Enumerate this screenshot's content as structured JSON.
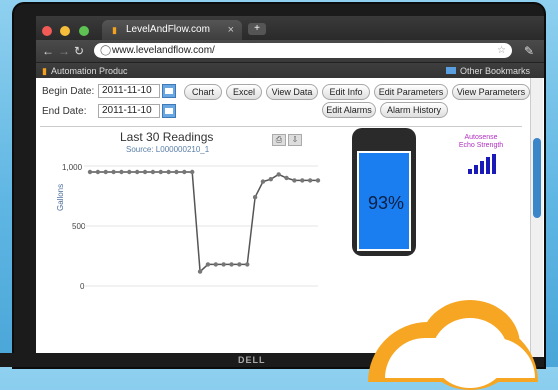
{
  "browser": {
    "tab_title": "LevelAndFlow.com",
    "tab_close": "×",
    "new_tab": "+",
    "url": "www.levelandflow.com/",
    "bookmark_left": "Automation Produc",
    "bookmark_right": "Other Bookmarks"
  },
  "form": {
    "begin_label": "Begin Date:",
    "begin_value": "2011-11-10",
    "end_label": "End Date:",
    "end_value": "2011-11-10"
  },
  "buttons": {
    "chart": "Chart",
    "excel": "Excel",
    "view_data": "View Data",
    "edit_info": "Edit Info",
    "edit_parameters": "Edit Parameters",
    "view_parameters": "View Parameters",
    "edit_alarms": "Edit Alarms",
    "alarm_history": "Alarm History"
  },
  "chart_data": {
    "type": "line",
    "title": "Last 30 Readings",
    "subtitle": "Source: L000000210_1",
    "ylabel": "Gallons",
    "ylim": [
      0,
      1000
    ],
    "yticks": [
      "1,000",
      "500",
      "0"
    ],
    "values": [
      950,
      950,
      950,
      950,
      950,
      950,
      950,
      950,
      950,
      950,
      950,
      950,
      950,
      950,
      120,
      180,
      180,
      180,
      180,
      180,
      180,
      740,
      870,
      890,
      930,
      900,
      880,
      880,
      880,
      880
    ]
  },
  "tank": {
    "percent": "93%",
    "fill_fraction": 0.93
  },
  "autosense": {
    "label": "Autosense Echo Strength",
    "bars": [
      0.25,
      0.45,
      0.65,
      0.85,
      1.0
    ]
  },
  "brand": {
    "laptop_logo": "DELL"
  },
  "colors": {
    "accent": "#1a7ef0",
    "line": "#555555",
    "autosense_label": "#b030c0"
  }
}
